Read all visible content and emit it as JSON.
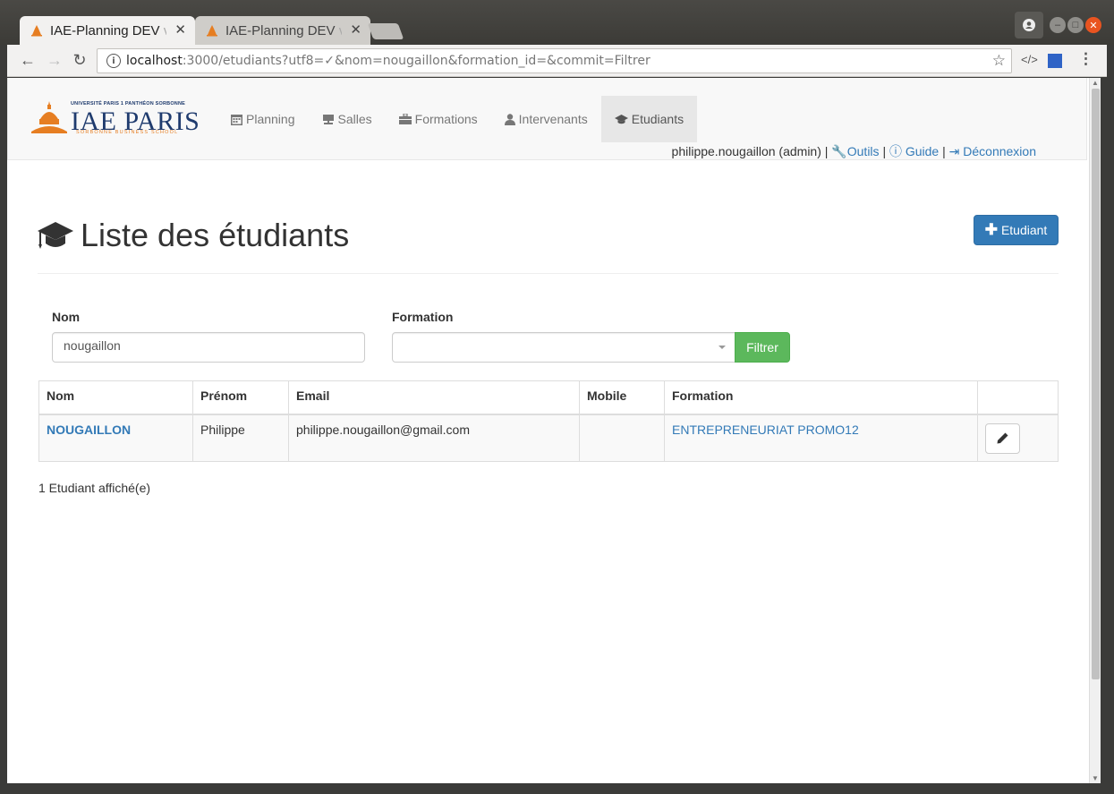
{
  "browser": {
    "tabs": [
      {
        "title": "IAE-Planning DEV",
        "title_fade": " v"
      },
      {
        "title": "IAE-Planning DEV",
        "title_fade": " v"
      }
    ],
    "url_host": "localhost",
    "url_path": ":3000/etudiants?utf8=✓&nom=nougaillon&formation_id=&commit=Filtrer"
  },
  "brand": {
    "university": "UNIVERSITÉ PARIS 1 PANTHÉON SORBONNE",
    "name": "IAE PARIS",
    "tagline": "SORBONNE BUSINESS SCHOOL"
  },
  "nav": {
    "items": [
      {
        "label": "Planning",
        "icon": "calendar-icon"
      },
      {
        "label": "Salles",
        "icon": "easel-icon"
      },
      {
        "label": "Formations",
        "icon": "briefcase-icon"
      },
      {
        "label": "Intervenants",
        "icon": "user-icon"
      },
      {
        "label": "Etudiants",
        "icon": "graduation-cap-icon"
      }
    ],
    "active": "Etudiants"
  },
  "user": {
    "name": "philippe.nougaillon (admin)",
    "sep": "|",
    "tools": "Outils",
    "guide": "Guide",
    "logout": "Déconnexion"
  },
  "page": {
    "title": "Liste des étudiants",
    "add_button": "Etudiant"
  },
  "filters": {
    "nom_label": "Nom",
    "nom_value": "nougaillon",
    "formation_label": "Formation",
    "formation_value": "",
    "submit": "Filtrer"
  },
  "table": {
    "headers": [
      "Nom",
      "Prénom",
      "Email",
      "Mobile",
      "Formation",
      ""
    ],
    "rows": [
      {
        "nom": "NOUGAILLON",
        "prenom": "Philippe",
        "email": "philippe.nougaillon@gmail.com",
        "mobile": "",
        "formation": "ENTREPRENEURIAT PROMO12"
      }
    ]
  },
  "count_text": "1 Etudiant affiché(e)",
  "colors": {
    "primary": "#337ab7",
    "success": "#5cb85c",
    "brand_blue": "#1f3b6e",
    "brand_orange": "#e67e22"
  }
}
